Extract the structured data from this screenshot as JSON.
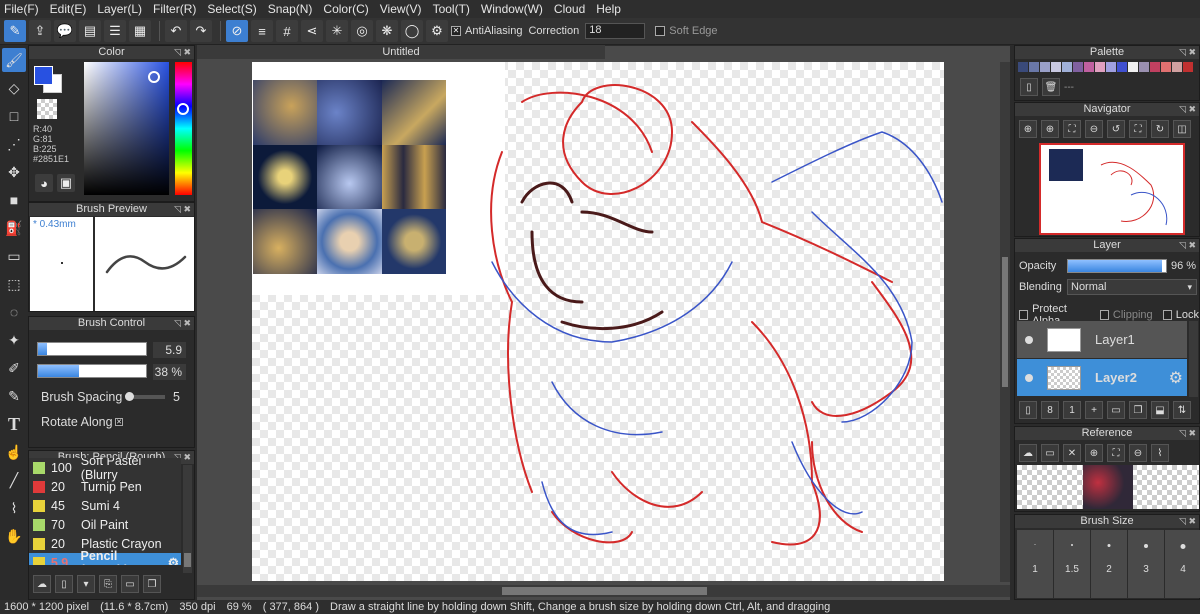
{
  "menu": [
    "File(F)",
    "Edit(E)",
    "Layer(L)",
    "Filter(R)",
    "Select(S)",
    "Snap(N)",
    "Color(C)",
    "View(V)",
    "Tool(T)",
    "Window(W)",
    "Cloud",
    "Help"
  ],
  "toolbar": {
    "antialiasing": "AntiAliasing",
    "correction_label": "Correction",
    "correction_value": "18",
    "soft_edge": "Soft Edge"
  },
  "color_panel": {
    "title": "Color",
    "r": "R:40",
    "g": "G:81",
    "b": "B:225",
    "hex": "#2851E1",
    "fg": "#2851E1"
  },
  "brush_preview": {
    "title": "Brush Preview",
    "size": "* 0.43mm"
  },
  "brush_control": {
    "title": "Brush Control",
    "size_value": "5.9",
    "opacity_value": "38 %",
    "size_fill": 0.08,
    "opacity_fill": 0.38,
    "spacing_label": "Brush Spacing",
    "spacing_value": "5",
    "rotate_label": "Rotate Along"
  },
  "brush_list": {
    "title": "Brush: Pencil (Rough)",
    "items": [
      {
        "size": "100",
        "name": "Soft Pastel (Blurry",
        "color": "#a8d96a"
      },
      {
        "size": "20",
        "name": "Turnip Pen",
        "color": "#e03a3a"
      },
      {
        "size": "45",
        "name": "Sumi 4",
        "color": "#e8d23a"
      },
      {
        "size": "70",
        "name": "Oil Paint",
        "color": "#a8d96a"
      },
      {
        "size": "20",
        "name": "Plastic Crayon",
        "color": "#e8d23a"
      },
      {
        "size": "5.9",
        "name": "Pencil (Rough)",
        "color": "#e8d23a",
        "selected": true
      }
    ]
  },
  "document": {
    "title": "Untitled"
  },
  "palette": {
    "title": "Palette",
    "add_label": "---",
    "colors": [
      "#3a4a7a",
      "#6a78a8",
      "#9aa0c8",
      "#c8c8e0",
      "#a0b0d8",
      "#8060a0",
      "#c060a0",
      "#e0a0c0",
      "#a0a0e0",
      "#4050d0",
      "#f0f0f0",
      "#9a90b0",
      "#c04060",
      "#e07070",
      "#d0a0a0",
      "#c03030"
    ]
  },
  "navigator": {
    "title": "Navigator"
  },
  "layer": {
    "title": "Layer",
    "opacity_label": "Opacity",
    "opacity_value": "96 %",
    "opacity_fill": 0.96,
    "blending_label": "Blending",
    "blending_value": "Normal",
    "protect_alpha": "Protect Alpha",
    "clipping": "Clipping",
    "lock": "Lock",
    "items": [
      {
        "name": "Layer1",
        "selected": false
      },
      {
        "name": "Layer2",
        "selected": true
      }
    ]
  },
  "reference": {
    "title": "Reference"
  },
  "brush_size": {
    "title": "Brush Size",
    "sizes": [
      "1",
      "1.5",
      "2",
      "3",
      "4"
    ]
  },
  "status": {
    "dims": "1600 * 1200 pixel",
    "cm": "(11.6 * 8.7cm)",
    "dpi": "350 dpi",
    "zoom": "69 %",
    "coords": "( 377, 864 )",
    "hint": "Draw a straight line by holding down Shift, Change a brush size by holding down Ctrl, Alt, and dragging"
  }
}
